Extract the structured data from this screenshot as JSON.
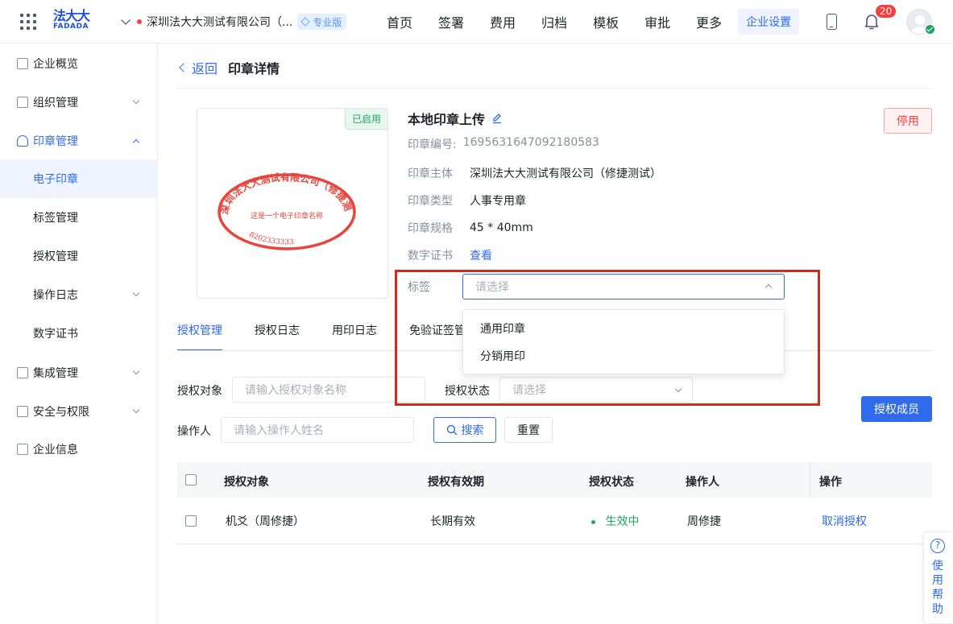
{
  "header": {
    "logo_cn": "法大大",
    "logo_en": "FADADA",
    "company": "深圳法大大测试有限公司（...",
    "edition_badge": "专业版",
    "nav": [
      "首页",
      "签署",
      "费用",
      "归档",
      "模板",
      "审批",
      "更多"
    ],
    "nav_active": "企业设置",
    "notification_count": "20"
  },
  "sidebar": {
    "items": [
      {
        "label": "企业概览"
      },
      {
        "label": "组织管理"
      },
      {
        "label": "印章管理"
      },
      {
        "label": "电子印章"
      },
      {
        "label": "标签管理"
      },
      {
        "label": "授权管理"
      },
      {
        "label": "操作日志"
      },
      {
        "label": "数字证书"
      },
      {
        "label": "集成管理"
      },
      {
        "label": "安全与权限"
      },
      {
        "label": "企业信息"
      }
    ]
  },
  "page": {
    "back": "返回",
    "title": "印章详情",
    "stop_button": "停用"
  },
  "seal": {
    "status_tag": "已启用",
    "name": "本地印章上传",
    "no_label": "印章编号:",
    "no_value": "1695631647092180583",
    "stamp_text_arc": "深圳法大大测试有限公司（修捷测试）",
    "stamp_text_center": "这是一个电子印章名称",
    "stamp_text_bottom": "8202333333",
    "details": [
      {
        "label": "印章主体",
        "value": "深圳法大大测试有限公司（修捷测试）"
      },
      {
        "label": "印章类型",
        "value": "人事专用章"
      },
      {
        "label": "印章规格",
        "value": "45 * 40mm"
      },
      {
        "label": "数字证书",
        "value": "查看"
      }
    ],
    "tag_label": "标签",
    "tag_placeholder": "请选择",
    "tag_options": [
      "通用印章",
      "分销用印"
    ]
  },
  "tabs": [
    "授权管理",
    "授权日志",
    "用印日志",
    "免验证签管"
  ],
  "filters": {
    "target_label": "授权对象",
    "target_placeholder": "请输入授权对象名称",
    "status_label": "授权状态",
    "status_placeholder": "请选择",
    "operator_label": "操作人",
    "operator_placeholder": "请输入操作人姓名",
    "search_button": "搜索",
    "reset_button": "重置",
    "authorize_button": "授权成员"
  },
  "table": {
    "headers": [
      "授权对象",
      "授权有效期",
      "授权状态",
      "操作人",
      "操作"
    ],
    "rows": [
      {
        "target": "机爻（周修捷）",
        "validity": "长期有效",
        "status": "生效中",
        "operator": "周修捷",
        "action": "取消授权"
      }
    ]
  },
  "help": {
    "icon": "?",
    "text": "使用帮助"
  },
  "colors": {
    "primary": "#2f6bea",
    "success": "#1ea560",
    "danger": "#f53f3f",
    "highlight": "#d12b1e",
    "stamp": "#e8453c"
  }
}
